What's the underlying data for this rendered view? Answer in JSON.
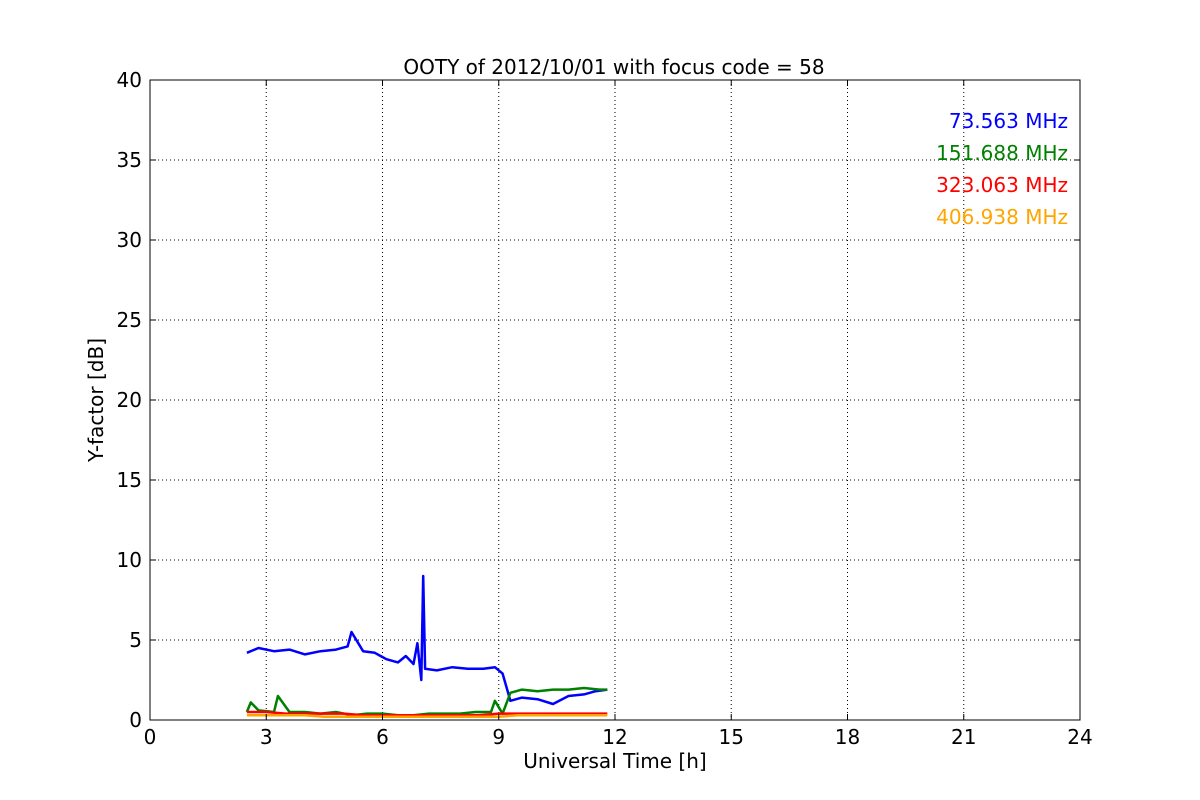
{
  "chart_data": {
    "type": "line",
    "title": "OOTY of 2012/10/01 with focus code = 58",
    "xlabel": "Universal Time [h]",
    "ylabel": "Y-factor [dB]",
    "xlim": [
      0,
      24
    ],
    "ylim": [
      0,
      40
    ],
    "xticks": [
      0,
      3,
      6,
      9,
      12,
      15,
      18,
      21,
      24
    ],
    "yticks": [
      0,
      5,
      10,
      15,
      20,
      25,
      30,
      35,
      40
    ],
    "grid": true,
    "legend_placement": "top-right",
    "series": [
      {
        "name": "73.563 MHz",
        "color": "#0000ff",
        "x": [
          2.5,
          2.8,
          3.2,
          3.6,
          4.0,
          4.4,
          4.8,
          5.1,
          5.2,
          5.5,
          5.8,
          6.1,
          6.4,
          6.6,
          6.8,
          6.9,
          7.0,
          7.05,
          7.1,
          7.4,
          7.8,
          8.2,
          8.6,
          8.9,
          9.1,
          9.3,
          9.6,
          10.0,
          10.4,
          10.8,
          11.2,
          11.5,
          11.8
        ],
        "y": [
          4.2,
          4.5,
          4.3,
          4.4,
          4.1,
          4.3,
          4.4,
          4.6,
          5.5,
          4.3,
          4.2,
          3.8,
          3.6,
          4.0,
          3.5,
          4.8,
          2.5,
          9.0,
          3.2,
          3.1,
          3.3,
          3.2,
          3.2,
          3.3,
          2.9,
          1.2,
          1.4,
          1.3,
          1.0,
          1.5,
          1.6,
          1.8,
          1.9
        ]
      },
      {
        "name": "151.688 MHz",
        "color": "#008000",
        "x": [
          2.5,
          2.6,
          2.8,
          3.2,
          3.3,
          3.6,
          4.0,
          4.4,
          4.8,
          5.2,
          5.6,
          6.0,
          6.4,
          6.8,
          7.2,
          7.6,
          8.0,
          8.4,
          8.8,
          8.9,
          9.1,
          9.3,
          9.6,
          10.0,
          10.4,
          10.8,
          11.2,
          11.6,
          11.8
        ],
        "y": [
          0.5,
          1.1,
          0.6,
          0.5,
          1.5,
          0.5,
          0.5,
          0.4,
          0.5,
          0.3,
          0.4,
          0.4,
          0.3,
          0.3,
          0.4,
          0.4,
          0.4,
          0.5,
          0.5,
          1.2,
          0.4,
          1.7,
          1.9,
          1.8,
          1.9,
          1.9,
          2.0,
          1.9,
          1.9
        ]
      },
      {
        "name": "323.063 MHz",
        "color": "#ff0000",
        "x": [
          2.5,
          3.0,
          3.5,
          4.0,
          4.5,
          5.0,
          5.5,
          6.0,
          6.5,
          7.0,
          7.5,
          8.0,
          8.5,
          9.0,
          9.5,
          10.0,
          10.5,
          11.0,
          11.5,
          11.8
        ],
        "y": [
          0.5,
          0.5,
          0.4,
          0.4,
          0.4,
          0.4,
          0.3,
          0.3,
          0.3,
          0.3,
          0.3,
          0.3,
          0.3,
          0.4,
          0.4,
          0.4,
          0.4,
          0.4,
          0.4,
          0.4
        ]
      },
      {
        "name": "406.938 MHz",
        "color": "#ffa500",
        "x": [
          2.5,
          3.0,
          3.5,
          4.0,
          4.5,
          5.0,
          5.5,
          6.0,
          6.5,
          7.0,
          7.5,
          8.0,
          8.5,
          9.0,
          9.5,
          10.0,
          10.5,
          11.0,
          11.5,
          11.8
        ],
        "y": [
          0.3,
          0.3,
          0.3,
          0.3,
          0.2,
          0.2,
          0.2,
          0.2,
          0.2,
          0.2,
          0.2,
          0.2,
          0.2,
          0.2,
          0.3,
          0.3,
          0.3,
          0.3,
          0.3,
          0.3
        ]
      }
    ]
  }
}
